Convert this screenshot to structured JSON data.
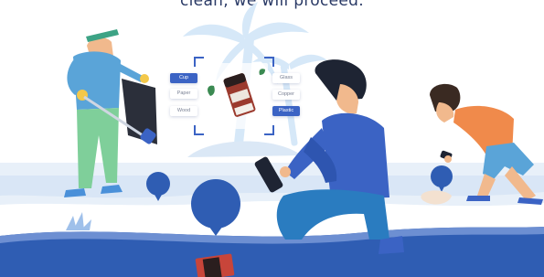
{
  "headline": "clean, we will proceed.",
  "tags": {
    "left": [
      "Cup",
      "Paper",
      "Wood"
    ],
    "right": [
      "Glass",
      "Copper",
      "Plastic"
    ],
    "active_left": "Cup",
    "active_right": "Plastic"
  },
  "colors": {
    "accent": "#3b63c4",
    "palm": "#cfe3f6",
    "water": "#2f5db3",
    "sand": "#f4f7fb"
  },
  "icons": [
    "palm-tree",
    "water-drop",
    "grass-tuft",
    "recycle-scan-frame",
    "leaf"
  ]
}
